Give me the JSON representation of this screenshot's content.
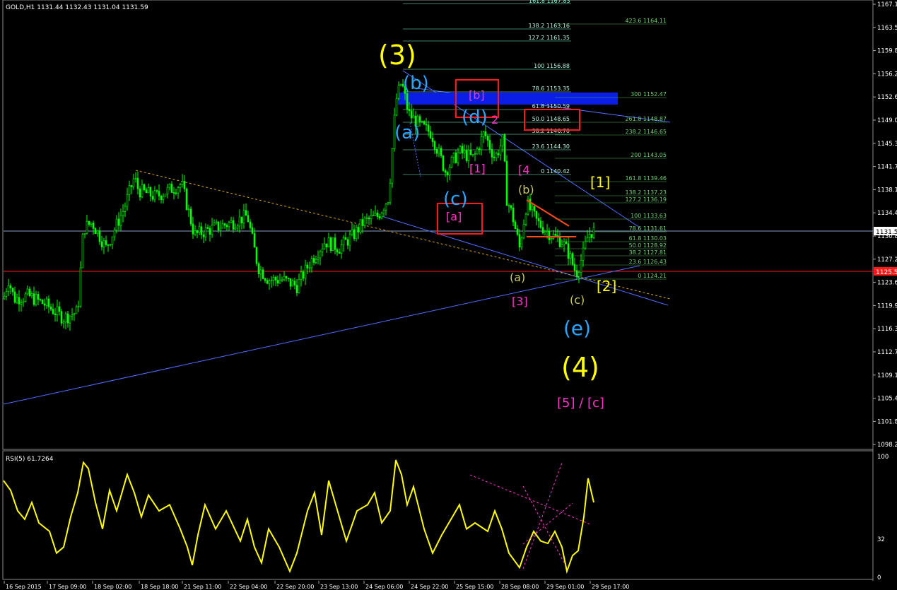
{
  "header": {
    "title": "GOLD,H1  1131.44 1132.43 1131.04 1131.59"
  },
  "rsi_header": {
    "title": "RSI(5) 61.7264"
  },
  "price_axis": {
    "ticks": [
      "1167.1",
      "1163.5",
      "1159.8",
      "1156.2",
      "1152.6",
      "1149.0",
      "1145.3",
      "1141.7",
      "1138.1",
      "1134.4",
      "1130.8",
      "1127.2",
      "1123.6",
      "1119.9",
      "1116.3",
      "1112.7",
      "1109.1",
      "1105.4",
      "1101.8",
      "1098.2"
    ],
    "current_price": "1131.5",
    "marker_price": "1125.5"
  },
  "rsi_axis": {
    "ticks": [
      "100",
      "32",
      "0"
    ]
  },
  "time_axis": {
    "labels": [
      "16 Sep 2015",
      "17 Sep 09:00",
      "18 Sep 02:00",
      "18 Sep 18:00",
      "21 Sep 11:00",
      "22 Sep 04:00",
      "22 Sep 20:00",
      "23 Sep 13:00",
      "24 Sep 06:00",
      "24 Sep 22:00",
      "25 Sep 15:00",
      "28 Sep 08:00",
      "29 Sep 01:00",
      "29 Sep 17:00"
    ]
  },
  "fib_levels": {
    "top_cut": "161.8 1167.83",
    "set_a": [
      "138.2 1163.16",
      "127.2 1161.35",
      "100 1156.88",
      "78.6 1153.35",
      "61.8 1150.59",
      "50.0 1148.65",
      "38.2 1146.70",
      "23.6 1144.30",
      "0 1140.42"
    ],
    "set_b": [
      "423.6 1164.11",
      "300 1152.47",
      "261.8 1148.87",
      "238.2 1146.65",
      "200 1143.05",
      "161.8 1139.46",
      "138.2 1137.23",
      "127.2 1136.19",
      "100 1133.63",
      "78.6 1131.61",
      "61.8 1130.03",
      "50.0 1128.92",
      "38.2 1127.81",
      "23.6 1126.43",
      "0 1124.21"
    ]
  },
  "wave_labels": {
    "w3": "(3)",
    "wb": "(b)",
    "wa": "(a)",
    "wd": "(d)",
    "wc": "(c)",
    "we": "(e)",
    "w4": "(4)",
    "pb": "[b]",
    "p2": "2",
    "p1": "[1]",
    "p4": "[4",
    "pa": "[a]",
    "p3": "[3]",
    "p5c": "[5] / [c]",
    "g_b": "(b)",
    "g_a": "(a)",
    "g_c": "(c)",
    "y1": "[1]",
    "y2": "[2]"
  },
  "chart_data": [
    {
      "type": "line",
      "title": "GOLD,H1",
      "subtitle": "1131.44 1132.43 1131.04 1131.59",
      "ylim": [
        1098.2,
        1167.1
      ],
      "x": [
        "16 Sep 2015",
        "17 Sep 09:00",
        "18 Sep 02:00",
        "18 Sep 18:00",
        "21 Sep 11:00",
        "22 Sep 04:00",
        "22 Sep 20:00",
        "23 Sep 13:00",
        "24 Sep 06:00",
        "24 Sep 22:00",
        "25 Sep 15:00",
        "28 Sep 08:00",
        "29 Sep 01:00",
        "29 Sep 17:00"
      ],
      "series": [
        {
          "values": [
            1121.0,
            1119.5,
            1135.0,
            1139.5,
            1137.0,
            1131.5,
            1124.5,
            1131.5,
            1156.0,
            1147.0,
            1144.0,
            1131.0,
            1126.0,
            1131.6
          ]
        }
      ],
      "grid": false
    },
    {
      "type": "line",
      "title": "RSI(5) 61.7264",
      "ylim": [
        0,
        100
      ],
      "series": [
        {
          "values": [
            80,
            55,
            70,
            38,
            95,
            60,
            85,
            30,
            70,
            45,
            88,
            25,
            72,
            40,
            97,
            55,
            30,
            62
          ]
        }
      ]
    }
  ],
  "colors": {
    "background": "#000000",
    "candle": "#00ff00",
    "rsi_line": "#ffff00",
    "fib_a": "#7fffd4",
    "fib_b": "#4caf50",
    "trendline": "#4f6dff",
    "support": "#ff0000",
    "wave_yellow": "#ffff00",
    "wave_cyan": "#2aa6ff",
    "wave_magenta": "#ff33cc",
    "wave_olive": "#c8c864"
  }
}
